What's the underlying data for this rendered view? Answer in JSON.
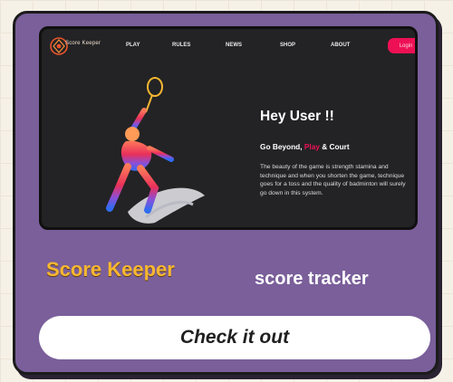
{
  "preview": {
    "logo_text": "Score Keeper",
    "nav": [
      "PLAY",
      "RULES",
      "NEWS",
      "SHOP",
      "ABOUT"
    ],
    "login_label": "Login",
    "headline": "Hey User !!",
    "tagline": {
      "before": "Go Beyond, ",
      "highlight": "Play",
      "after": " & Court"
    },
    "description": "The beauty of the game is strength stamina and technique and when you shorten the game, technique goes for a toss and the quality of badminton will surely go down in this system.",
    "accent_color": "#ee1055"
  },
  "card": {
    "title": "Score Keeper",
    "subtitle": "score tracker",
    "cta_label": "Check it out",
    "background_color": "#7a5f9a",
    "title_color": "#f7b731"
  }
}
